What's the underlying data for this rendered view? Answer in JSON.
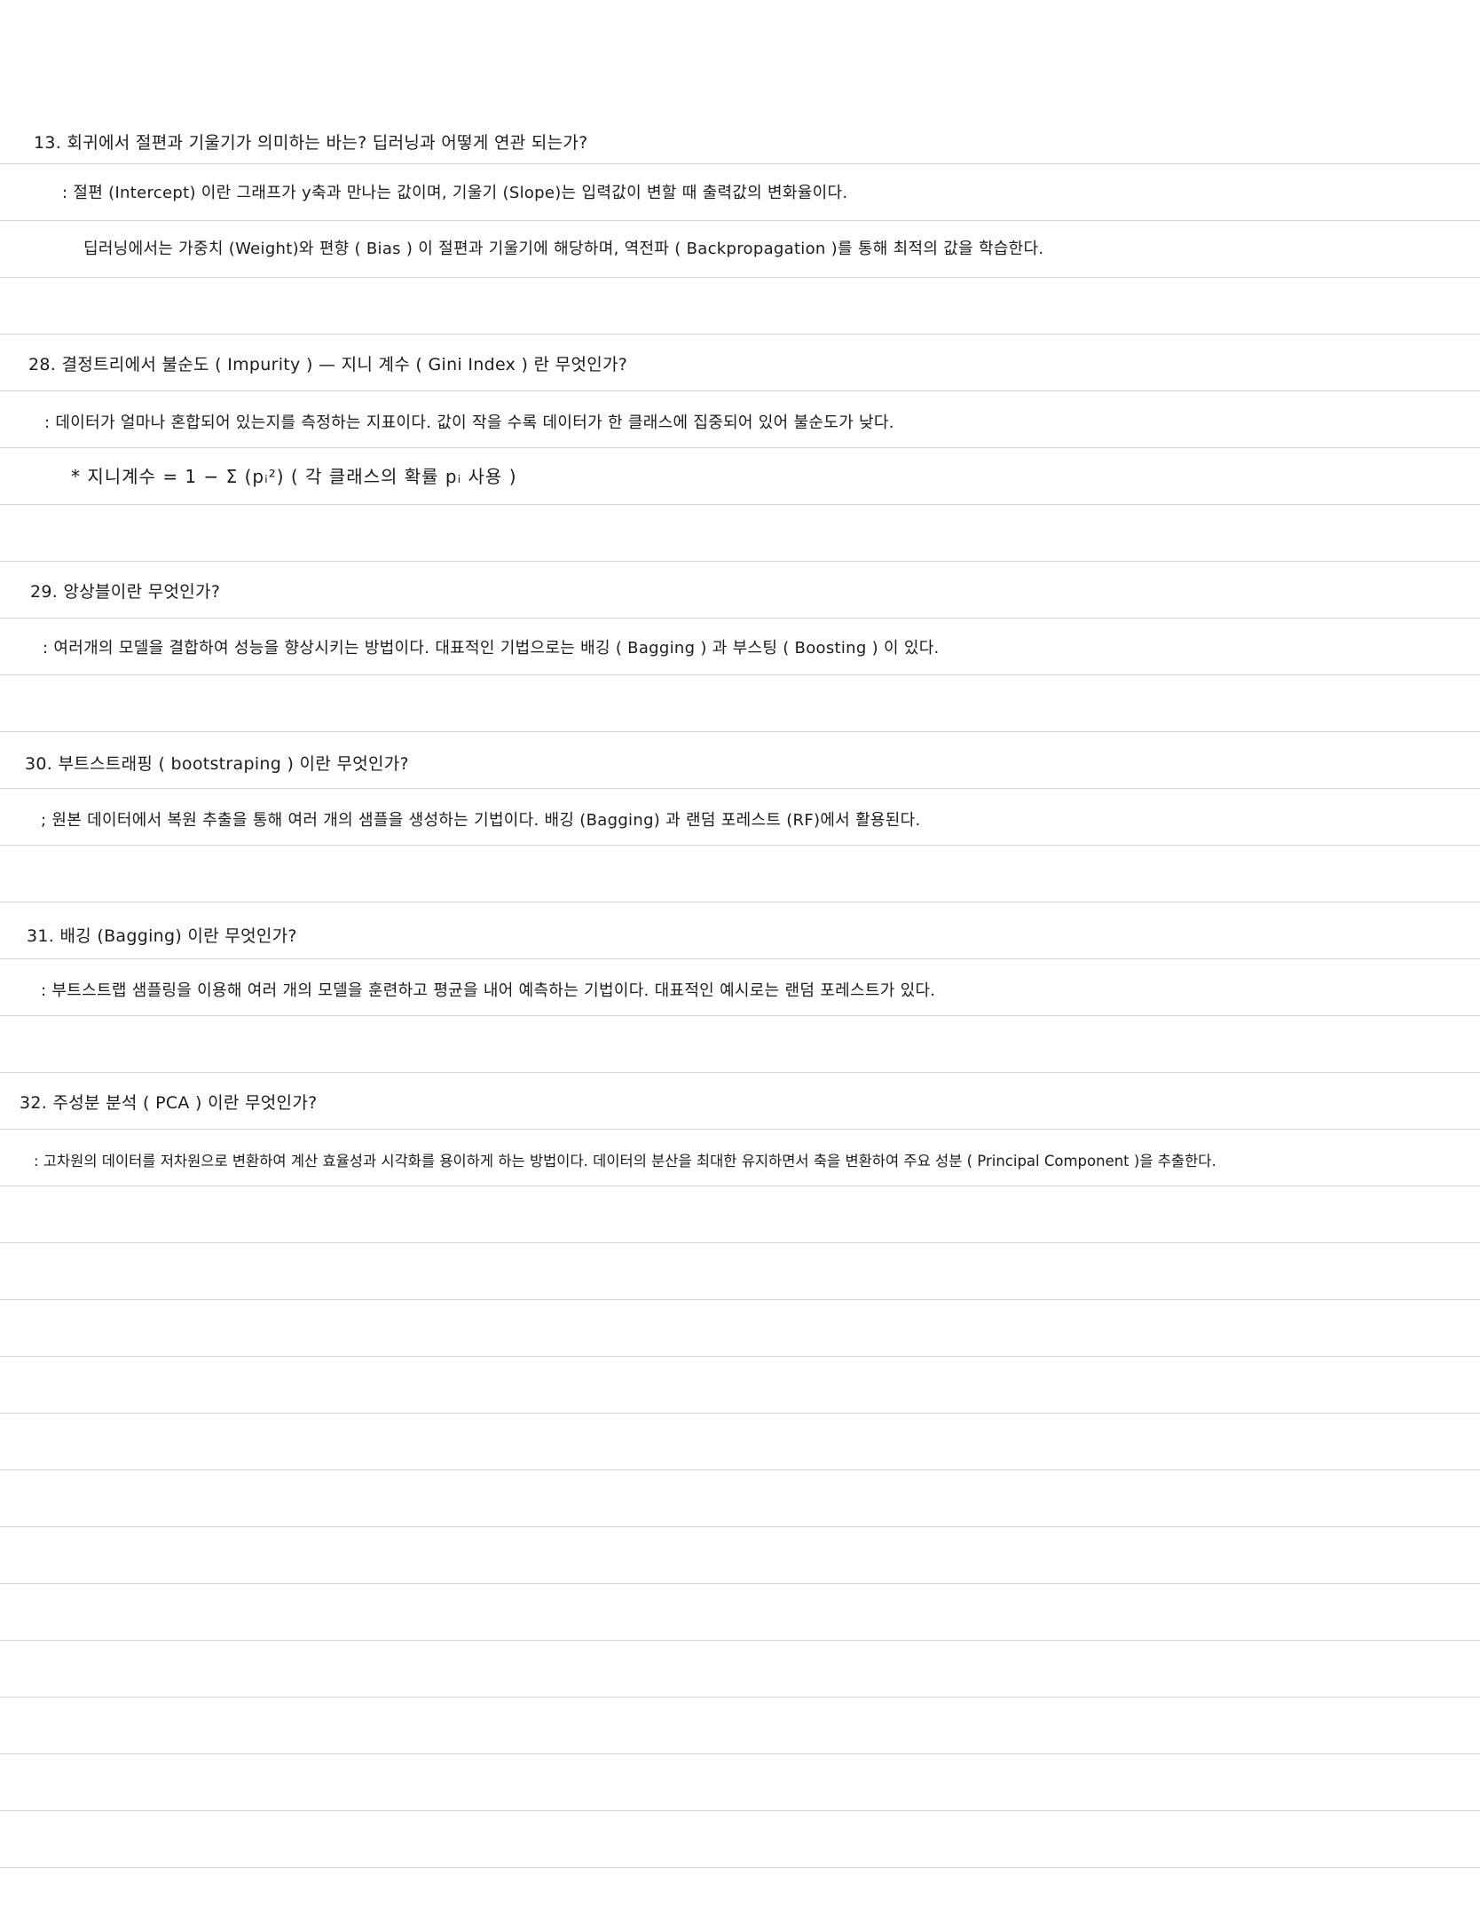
{
  "notes": [
    {
      "question": "13.  회귀에서 절편과 기울기가 의미하는 바는? 딥러닝과 어떻게 연관 되는가?",
      "answers": [
        ":  절편 (Intercept) 이란  그래프가 y축과 만나는 값이며, 기울기 (Slope)는  입력값이  변할 때  출력값의  변화율이다.",
        "딥러닝에서는  가중치 (Weight)와  편향 ( Bias ) 이  절편과 기울기에  해당하며,  역전파 ( Backpropagation )를 통해  최적의 값을  학습한다."
      ]
    },
    {
      "question": "28.  결정트리에서 불순도 ( Impurity )  —  지니 계수 ( Gini Index ) 란  무엇인가?",
      "answers": [
        ":  데이터가 얼마나 혼합되어 있는지를 측정하는 지표이다.  값이 작을 수록  데이터가 한 클래스에  집중되어 있어  불순도가  낮다.",
        "* 지니계수  =  1  −  Σ (pᵢ²)     ( 각  클래스의  확률  pᵢ  사용 )"
      ]
    },
    {
      "question": "29.  앙상블이란  무엇인가?",
      "answers": [
        ":  여러개의  모델을  결합하여  성능을  향상시키는  방법이다.  대표적인  기법으로는  배깅 ( Bagging ) 과  부스팅 ( Boosting ) 이  있다."
      ]
    },
    {
      "question": "30.  부트스트래핑 ( bootstraping ) 이란  무엇인가?",
      "answers": [
        ";  원본  데이터에서  복원  추출을  통해  여러 개의  샘플을  생성하는  기법이다.  배깅 (Bagging) 과  랜덤 포레스트 (RF)에서  활용된다."
      ]
    },
    {
      "question": "31.  배깅 (Bagging) 이란  무엇인가?",
      "answers": [
        ":  부트스트랩 샘플링을  이용해  여러 개의  모델을  훈련하고  평균을  내어  예측하는  기법이다.  대표적인  예시로는  랜덤  포레스트가  있다."
      ]
    },
    {
      "question": "32.  주성분  분석 ( PCA ) 이란  무엇인가?",
      "answers": [
        ":  고차원의  데이터를  저차원으로  변환하여  계산  효율성과  시각화를  용이하게  하는  방법이다.  데이터의  분산을  최대한  유지하면서  축을  변환하여  주요  성분 ( Principal  Component )을  추출한다."
      ]
    }
  ]
}
